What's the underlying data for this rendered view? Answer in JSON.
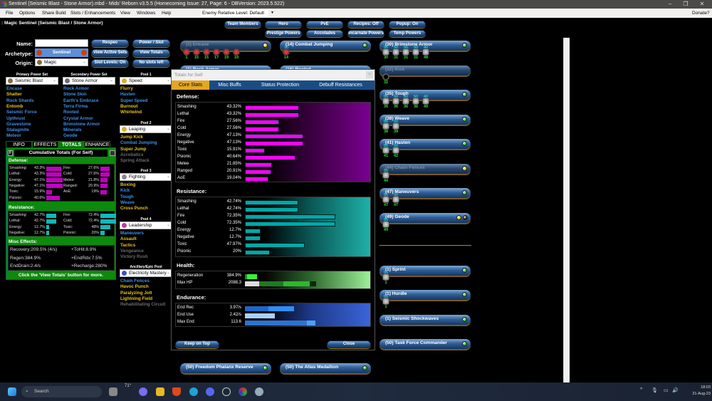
{
  "window": {
    "title": "Sentinel (Seismic Blast - Stone Armor).mbd - Mids' Reborn v3.5.5  (Homecoming Issue: 27, Page: 6 - DBVersion: 2023.5.522)",
    "minimize": "–",
    "maximize": "❐",
    "close": "✕"
  },
  "menu": {
    "items": [
      "File",
      "Options",
      "Share Build",
      "Slots / Enhancements",
      "View",
      "Windows",
      "Help"
    ],
    "enemy_level": "Enemy Relative Level: Default",
    "donate": "Donate?"
  },
  "build": {
    "header": ": Magic Sentinel (Seismic Blast / Stone Armor)",
    "name_label": "Name:",
    "name_value": "",
    "archetype_label": "Archetype:",
    "archetype": "Sentinel",
    "origin_label": "Origin:",
    "origin": "Magic"
  },
  "buttons": {
    "respec": "Respec",
    "power_slot": "Power / Slot",
    "view_active_sets": "View Active Sets",
    "view_totals": "View Totals",
    "slot_levels": "Slot Levels: On",
    "no_slots": "No slots left"
  },
  "top_buttons": [
    [
      "Team Members",
      "Hero",
      "PvE",
      "Recipes: Off",
      "Popup: On"
    ],
    [
      "Prestige Powers",
      "Accolades",
      "Incarnate Powers",
      "Temp Powers"
    ]
  ],
  "powersets": [
    {
      "label": "Primary Power Set",
      "value": "Seismic Blast",
      "icon_color": "#8a6a3a",
      "powers": [
        [
          "Encase",
          "blue"
        ],
        [
          "Shatter",
          "yellow"
        ],
        [
          "Rock Shards",
          "blue"
        ],
        [
          "Entomb",
          "yellow"
        ],
        [
          "Seismic Force",
          "blue"
        ],
        [
          "Upthrust",
          "blue"
        ],
        [
          "Gravestone",
          "blue"
        ],
        [
          "Stalagmite",
          "blue"
        ],
        [
          "Meteor",
          "blue"
        ]
      ]
    },
    {
      "label": "Secondary Power Set",
      "value": "Stone Armor",
      "icon_color": "#6a6a7a",
      "powers": [
        [
          "Rock Armor",
          "blue"
        ],
        [
          "Stone Skin",
          "blue"
        ],
        [
          "Earth's Embrace",
          "blue"
        ],
        [
          "Terra Firma",
          "blue"
        ],
        [
          "Rooted",
          "blue"
        ],
        [
          "Crystal Armor",
          "blue"
        ],
        [
          "Brimstone Armor",
          "blue"
        ],
        [
          "Minerals",
          "blue"
        ],
        [
          "Geode",
          "blue"
        ]
      ]
    },
    {
      "label": "Pool 1",
      "value": "Speed",
      "icon_color": "#d8b020",
      "powers": [
        [
          "Flurry",
          "yellow"
        ],
        [
          "Hasten",
          "blue"
        ],
        [
          "Super Speed",
          "blue"
        ],
        [
          "Burnout",
          "yellow"
        ],
        [
          "Whirlwind",
          "yellow"
        ]
      ]
    },
    {
      "label": "Pool 2",
      "value": "Leaping",
      "icon_color": "#d8b020",
      "powers": [
        [
          "Jump Kick",
          "yellow"
        ],
        [
          "Combat Jumping",
          "blue"
        ],
        [
          "Super Jump",
          "yellow"
        ],
        [
          "Acrobatics",
          "gray"
        ],
        [
          "Spring Attack",
          "gray"
        ]
      ]
    },
    {
      "label": "Pool 3",
      "value": "Fighting",
      "icon_color": "#888",
      "powers": [
        [
          "Boxing",
          "yellow"
        ],
        [
          "Kick",
          "blue"
        ],
        [
          "Tough",
          "blue"
        ],
        [
          "Weave",
          "blue"
        ],
        [
          "Cross Punch",
          "yellow"
        ]
      ]
    },
    {
      "label": "Pool 4",
      "value": "Leadership",
      "icon_color": "#c03aa0",
      "powers": [
        [
          "Maneuvers",
          "blue"
        ],
        [
          "Assault",
          "yellow"
        ],
        [
          "Tactics",
          "yellow"
        ],
        [
          "Vengeance",
          "gray"
        ],
        [
          "Victory Rush",
          "gray"
        ]
      ]
    },
    {
      "label": "Ancillary/Epic Pool",
      "value": "Electricity Mastery",
      "icon_color": "#4050c0",
      "powers": [
        [
          "Chain Fences",
          "blue"
        ],
        [
          "Havoc Punch",
          "yellow"
        ],
        [
          "Paralyzing Jolt",
          "yellow"
        ],
        [
          "Lightning Field",
          "yellow"
        ],
        [
          "Rehabilitating Circuit",
          "gray"
        ]
      ]
    }
  ],
  "info_tabs": {
    "items": [
      "INFO",
      "EFFECTS",
      "TOTALS",
      "ENHANCE"
    ],
    "active": "TOTALS"
  },
  "cumulative": {
    "title": "Cumulative Totals (For Self)",
    "f_button": "F",
    "defense_label": "Defense:",
    "resistance_label": "Resistance:",
    "misc_label": "Misc Effects:",
    "defense_left": [
      [
        "Smashing:",
        "43.3%",
        43.3
      ],
      [
        "Lethal:",
        "43.3%",
        43.3
      ],
      [
        "Energy:",
        "47.1%",
        47.1
      ],
      [
        "Negative:",
        "47.1%",
        47.1
      ],
      [
        "Toxic:",
        "15.9%",
        15.9
      ],
      [
        "Psionic:",
        "40.6%",
        40.6
      ]
    ],
    "defense_right": [
      [
        "Fire:",
        "27.6%",
        27.6
      ],
      [
        "Cold:",
        "27.6%",
        27.6
      ],
      [
        "Melee:",
        "21.8%",
        21.8
      ],
      [
        "Ranged:",
        "20.9%",
        20.9
      ],
      [
        "AoE:",
        "19%",
        19
      ]
    ],
    "resistance_left": [
      [
        "Smashing:",
        "42.7%",
        42.7
      ],
      [
        "Lethal:",
        "42.7%",
        42.7
      ],
      [
        "Energy:",
        "12.7%",
        12.7
      ],
      [
        "Negative:",
        "12.7%",
        12.7
      ]
    ],
    "resistance_right": [
      [
        "Fire:",
        "72.4%",
        72.4
      ],
      [
        "Cold:",
        "72.4%",
        72.4
      ],
      [
        "Toxic:",
        "48%",
        48
      ],
      [
        "Psionic:",
        "20%",
        20
      ]
    ],
    "misc": [
      [
        "Recovery:",
        "209.5% (4/s)"
      ],
      [
        "+ToHit:",
        "8.9%"
      ],
      [
        "Regen:",
        "384.9%"
      ],
      [
        "+EndRdx:",
        "7.5%"
      ],
      [
        "EndDrain:",
        "2.4/s"
      ],
      [
        "+Recharge:",
        "280%"
      ]
    ],
    "footer": "Click the 'View Totals' button for more."
  },
  "power_columns": [
    [
      {
        "label": "(1) Encase",
        "status": "yellow",
        "dim": true,
        "slots": [
          [
            "",
            1,
            "red"
          ],
          [
            "",
            15,
            "red"
          ],
          [
            "",
            15,
            "red"
          ],
          [
            "",
            17,
            "red"
          ],
          [
            "",
            19,
            "red"
          ],
          [
            "",
            19,
            "red"
          ]
        ]
      },
      {
        "label": "(1) Rock Armor",
        "status": "",
        "dim": false,
        "slots": []
      }
    ],
    [
      {
        "label": "(14) Combat Jumping",
        "status": "green",
        "dim": false,
        "slots": [
          [
            "30",
            14,
            "red"
          ]
        ]
      },
      {
        "label": "(16) Rooted",
        "status": "",
        "dim": false,
        "slots": []
      }
    ],
    [
      {
        "label": "(30) Brimstone Armor",
        "status": "green",
        "dim": false,
        "slots": [
          [
            "50",
            30,
            ""
          ],
          [
            "50",
            31,
            ""
          ],
          [
            "50",
            31,
            ""
          ],
          [
            "50",
            31,
            ""
          ],
          [
            "40",
            48,
            ""
          ]
        ]
      },
      {
        "label": "(32) Kick",
        "status": "",
        "dim": true,
        "slots": [
          [
            "",
            32,
            "empty"
          ]
        ]
      },
      {
        "label": "(35) Tough",
        "status": "green",
        "dim": false,
        "slots": [
          [
            "50",
            35,
            ""
          ],
          [
            "50",
            36,
            ""
          ],
          [
            "50",
            36,
            ""
          ],
          [
            "50",
            36,
            ""
          ],
          [
            "40",
            49,
            ""
          ]
        ]
      },
      {
        "label": "(38) Weave",
        "status": "green",
        "dim": false,
        "slots": [
          [
            "50",
            38,
            ""
          ],
          [
            "50",
            39,
            ""
          ]
        ]
      },
      {
        "label": "(41) Hasten",
        "status": "green",
        "dim": false,
        "slots": [
          [
            "50",
            41,
            ""
          ],
          [
            "50",
            42,
            ""
          ]
        ]
      },
      {
        "label": "(44) Chain Fences",
        "status": "yellow",
        "dim": true,
        "slots": [
          [
            "50",
            44,
            ""
          ]
        ]
      },
      {
        "label": "(47) Maneuvers",
        "status": "green",
        "dim": false,
        "slots": [
          [
            "50",
            47,
            ""
          ],
          [
            "50",
            47,
            ""
          ]
        ]
      },
      {
        "label": "(49) Geode",
        "status": "yellow+black",
        "dim": false,
        "slots": [
          [
            "50",
            49,
            ""
          ]
        ]
      }
    ]
  ],
  "inherent_powers": [
    {
      "label": "(1) Sprint",
      "status": "green",
      "slots": [
        [
          "50",
          1,
          ""
        ]
      ]
    },
    {
      "label": "(1) Hurdle",
      "status": "green",
      "slots": [
        [
          "50",
          1,
          ""
        ]
      ]
    },
    {
      "label": "(1) Seismic Shockwaves",
      "status": "green",
      "slots": []
    },
    {
      "label": "(50) Task Force Commander",
      "status": "green",
      "slots": []
    }
  ],
  "bottom_powers": [
    {
      "label": "(50) Freedom Phalanx Reserve",
      "status": "green"
    },
    {
      "label": "(50) The Atlas Medallion",
      "status": "green"
    }
  ],
  "status_colors": {
    "green": "#2fbf2f",
    "yellow": "#d6d21e",
    "black": "#222222"
  },
  "totals_dialog": {
    "title": "Totals for Self",
    "close": "×",
    "tabs": [
      "Core Stats",
      "Misc Buffs",
      "Status Protection",
      "Debuff Resistances"
    ],
    "active_tab": "Core Stats",
    "defense_label": "Defense:",
    "defense": [
      [
        "Smashing",
        "43.32%",
        43.32
      ],
      [
        "Lethal",
        "43.32%",
        43.32
      ],
      [
        "Fire",
        "27.56%",
        27.56
      ],
      [
        "Cold",
        "27.56%",
        27.56
      ],
      [
        "Energy",
        "47.13%",
        47.13
      ],
      [
        "Negative",
        "47.13%",
        47.13
      ],
      [
        "Toxic",
        "15.91%",
        15.91
      ],
      [
        "Psionic",
        "40.64%",
        40.64
      ],
      [
        "Melee",
        "21.85%",
        21.85
      ],
      [
        "Ranged",
        "20.91%",
        20.91
      ],
      [
        "AoE",
        "19.04%",
        19.04
      ]
    ],
    "resistance_label": "Resistance:",
    "resistance": [
      [
        "Smashing",
        "42.74%",
        42.74
      ],
      [
        "Lethal",
        "42.74%",
        42.74
      ],
      [
        "Fire",
        "72.35%",
        72.35
      ],
      [
        "Cold",
        "72.35%",
        72.35
      ],
      [
        "Energy",
        "12.7%",
        12.7
      ],
      [
        "Negative",
        "12.7%",
        12.7
      ],
      [
        "Toxic",
        "47.97%",
        47.97
      ],
      [
        "Psionic",
        "20%",
        20
      ]
    ],
    "health_label": "Health:",
    "health": [
      [
        "Regeneration",
        "384.9%"
      ],
      [
        "Max HP",
        "2088.3"
      ]
    ],
    "endurance_label": "Endurance:",
    "endurance": [
      [
        "End Rec",
        "3.97/s"
      ],
      [
        "End Use",
        "2.42/s"
      ],
      [
        "Max End",
        "113.6"
      ]
    ],
    "keep_on_top": "Keep on Top",
    "close_button": "Close",
    "colors": {
      "defense": "#ff00ff",
      "resistance": "#00a8a8",
      "health": "#33dd33",
      "endurance": "#2a7fe0"
    }
  },
  "taskbar": {
    "search": "Search",
    "weather": "71°",
    "time": "18:03",
    "date": "21-Aug-23"
  }
}
